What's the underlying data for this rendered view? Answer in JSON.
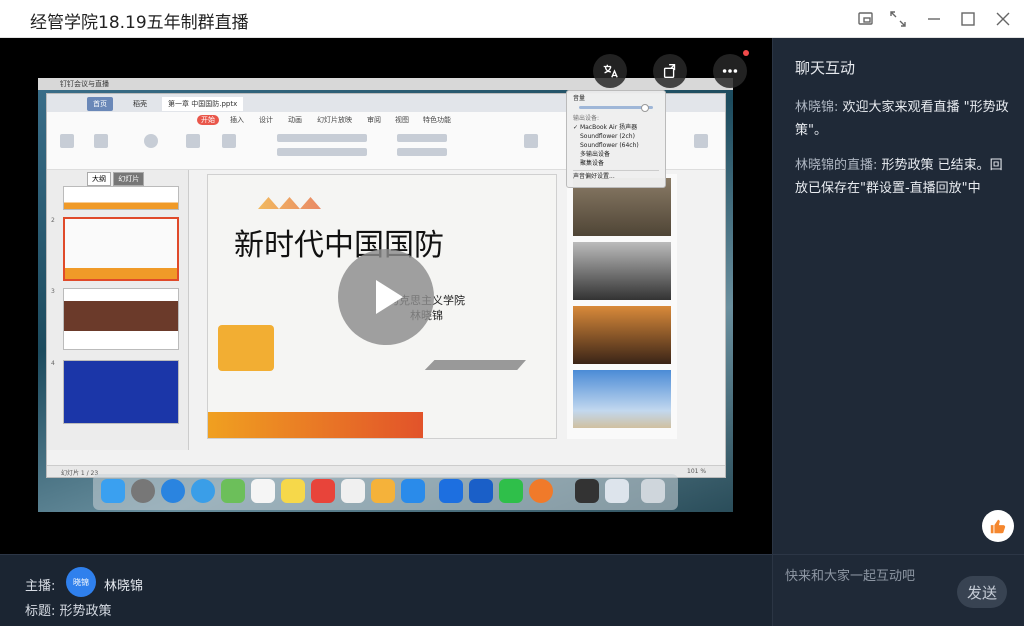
{
  "window": {
    "title": "经管学院18.19五年制群直播"
  },
  "icons": {
    "pip": "pip-icon",
    "expand": "expand-icon",
    "minimize": "minimize-icon",
    "maximize": "maximize-icon",
    "close": "close-icon"
  },
  "screen": {
    "mac_menu": "钉钉会议与直播",
    "wps_tabs": [
      "首页",
      "稻壳",
      "第一章 中国国防.pptx"
    ],
    "ribbon_tabs": [
      "开始",
      "插入",
      "设计",
      "动画",
      "幻灯片放映",
      "审阅",
      "视图",
      "特色功能"
    ],
    "thumb_tabs": [
      "大纲",
      "幻灯片"
    ],
    "slide_title": "新时代中国国防",
    "slide_subtitle_line1": "马克思主义学院",
    "slide_subtitle_line2": "林晓锦",
    "audio_menu": {
      "header": "音量",
      "output_label": "输出设备:",
      "devices": [
        "MacBook Air 扬声器",
        "Soundflower (2ch)",
        "Soundflower (64ch)",
        "多输出设备",
        "聚集设备"
      ],
      "prefs": "声音偏好设置...",
      "selected": "MacBook Air 扬声器"
    },
    "status_left": "幻灯片 1 / 23",
    "status_zoom": "101 %"
  },
  "chat": {
    "header": "聊天互动",
    "messages": [
      {
        "sender": "林晓锦:",
        "text": " 欢迎大家来观看直播 \"形势政策\"。"
      },
      {
        "sender": "林晓锦的直播:",
        "text": " 形势政策 已结束。回放已保存在\"群设置-直播回放\"中"
      }
    ],
    "input_placeholder": "快来和大家一起互动吧",
    "send_label": "发送"
  },
  "footer": {
    "host_label": "主播:",
    "avatar_text": "晓锦",
    "host_name": "林晓锦",
    "subject": "标题: 形势政策"
  },
  "colors": {
    "accent": "#2f80ed",
    "chat_bg": "#1f2937",
    "footer_bg": "#1b2532"
  }
}
